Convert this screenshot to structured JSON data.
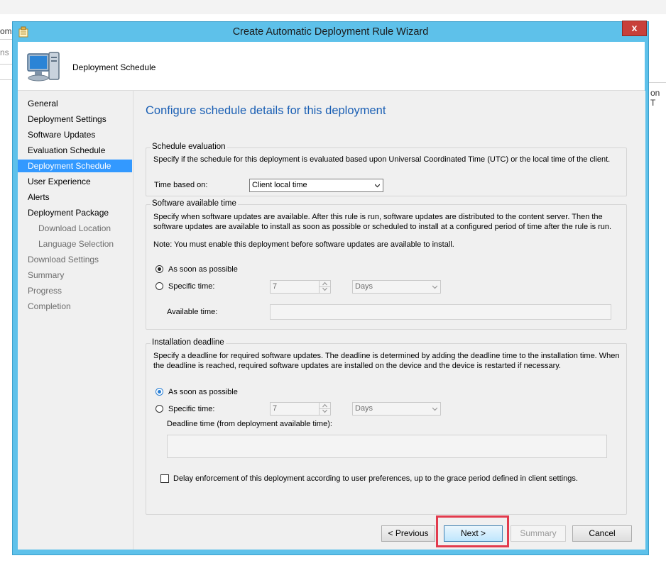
{
  "background": {
    "frag_top_left": "om",
    "frag_mid_left": "ns",
    "frag_right": "on T"
  },
  "window": {
    "title": "Create Automatic Deployment Rule Wizard",
    "close_label": "x"
  },
  "header": {
    "title": "Deployment Schedule"
  },
  "nav": {
    "items": [
      {
        "label": "General"
      },
      {
        "label": "Deployment Settings"
      },
      {
        "label": "Software Updates"
      },
      {
        "label": "Evaluation Schedule"
      },
      {
        "label": "Deployment Schedule"
      },
      {
        "label": "User Experience"
      },
      {
        "label": "Alerts"
      },
      {
        "label": "Deployment Package"
      },
      {
        "label": "Download Location"
      },
      {
        "label": "Language Selection"
      },
      {
        "label": "Download Settings"
      },
      {
        "label": "Summary"
      },
      {
        "label": "Progress"
      },
      {
        "label": "Completion"
      }
    ]
  },
  "page": {
    "heading": "Configure schedule details for this deployment"
  },
  "schedule_eval": {
    "title": "Schedule evaluation",
    "description": "Specify if the schedule for this deployment is evaluated based upon Universal Coordinated Time (UTC) or the local time of the client.",
    "time_label": "Time based on:",
    "time_value": "Client local time"
  },
  "available": {
    "title": "Software available time",
    "desc1": "Specify when software updates are available. After this rule is run, software updates are distributed to the content server. Then the",
    "desc2": "software updates are available to install as soon as possible or scheduled to install at a configured period of time after the rule is run.",
    "note": "Note: You must enable this deployment before software updates are available to install.",
    "asap_label": "As soon as possible",
    "specific_label": "Specific time:",
    "spin_value": "7",
    "unit_value": "Days",
    "available_time_label": "Available time:"
  },
  "deadline": {
    "title": "Installation deadline",
    "desc1": "Specify a deadline for required software updates. The deadline is determined by adding the deadline time to the installation time. When",
    "desc2": "the deadline is reached, required software updates are installed on the device and the device is restarted if necessary.",
    "asap_label": "As soon as possible",
    "specific_label": "Specific time:",
    "spin_value": "7",
    "unit_value": "Days",
    "deadline_time_label": "Deadline time (from deployment available time):",
    "delay_label": "Delay enforcement of this deployment according to user preferences, up to the grace period defined in client settings."
  },
  "buttons": {
    "previous": "< Previous",
    "next": "Next >",
    "summary": "Summary",
    "cancel": "Cancel"
  }
}
